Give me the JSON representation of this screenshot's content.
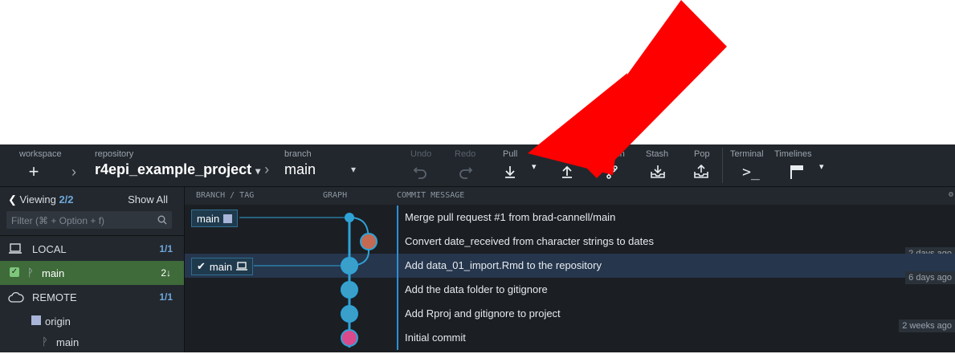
{
  "toolbar": {
    "workspace_label": "workspace",
    "repository_label": "repository",
    "repository_name": "r4epi_example_project",
    "branch_label": "branch",
    "branch_name": "main",
    "undo": "Undo",
    "redo": "Redo",
    "pull": "Pull",
    "push": "Push",
    "branch": "Branch",
    "stash": "Stash",
    "pop": "Pop",
    "terminal": "Terminal",
    "timelines": "Timelines"
  },
  "sidebar": {
    "viewing_label": "Viewing",
    "viewing_count": "2/2",
    "show_all": "Show All",
    "filter_placeholder": "Filter (⌘ + Option + f)",
    "local_label": "LOCAL",
    "local_count": "1/1",
    "local_branch": "main",
    "local_branch_status": "2↓",
    "remote_label": "REMOTE",
    "remote_count": "1/1",
    "remote_name": "origin",
    "remote_branch": "main"
  },
  "columns": {
    "branch_tag": "BRANCH / TAG",
    "graph": "GRAPH",
    "commit_message": "COMMIT MESSAGE"
  },
  "commits": [
    {
      "message": "Merge pull request #1 from brad-cannell/main",
      "tag": "main",
      "time": ""
    },
    {
      "message": "Convert date_received from character strings to dates",
      "tag": "",
      "time": "2 days ago"
    },
    {
      "message": "Add data_01_import.Rmd to the repository",
      "tag": "main",
      "time": "6 days ago"
    },
    {
      "message": "Add the data folder to gitignore",
      "tag": "",
      "time": ""
    },
    {
      "message": "Add Rproj and gitignore to project",
      "tag": "",
      "time": "2 weeks ago"
    },
    {
      "message": "Initial commit",
      "tag": "",
      "time": ""
    }
  ],
  "colors": {
    "annotation_arrow": "#ff0000",
    "selected_row": "#26364d",
    "local_branch_bg": "#3f6a3a",
    "graph_line": "#2fa3d8"
  }
}
